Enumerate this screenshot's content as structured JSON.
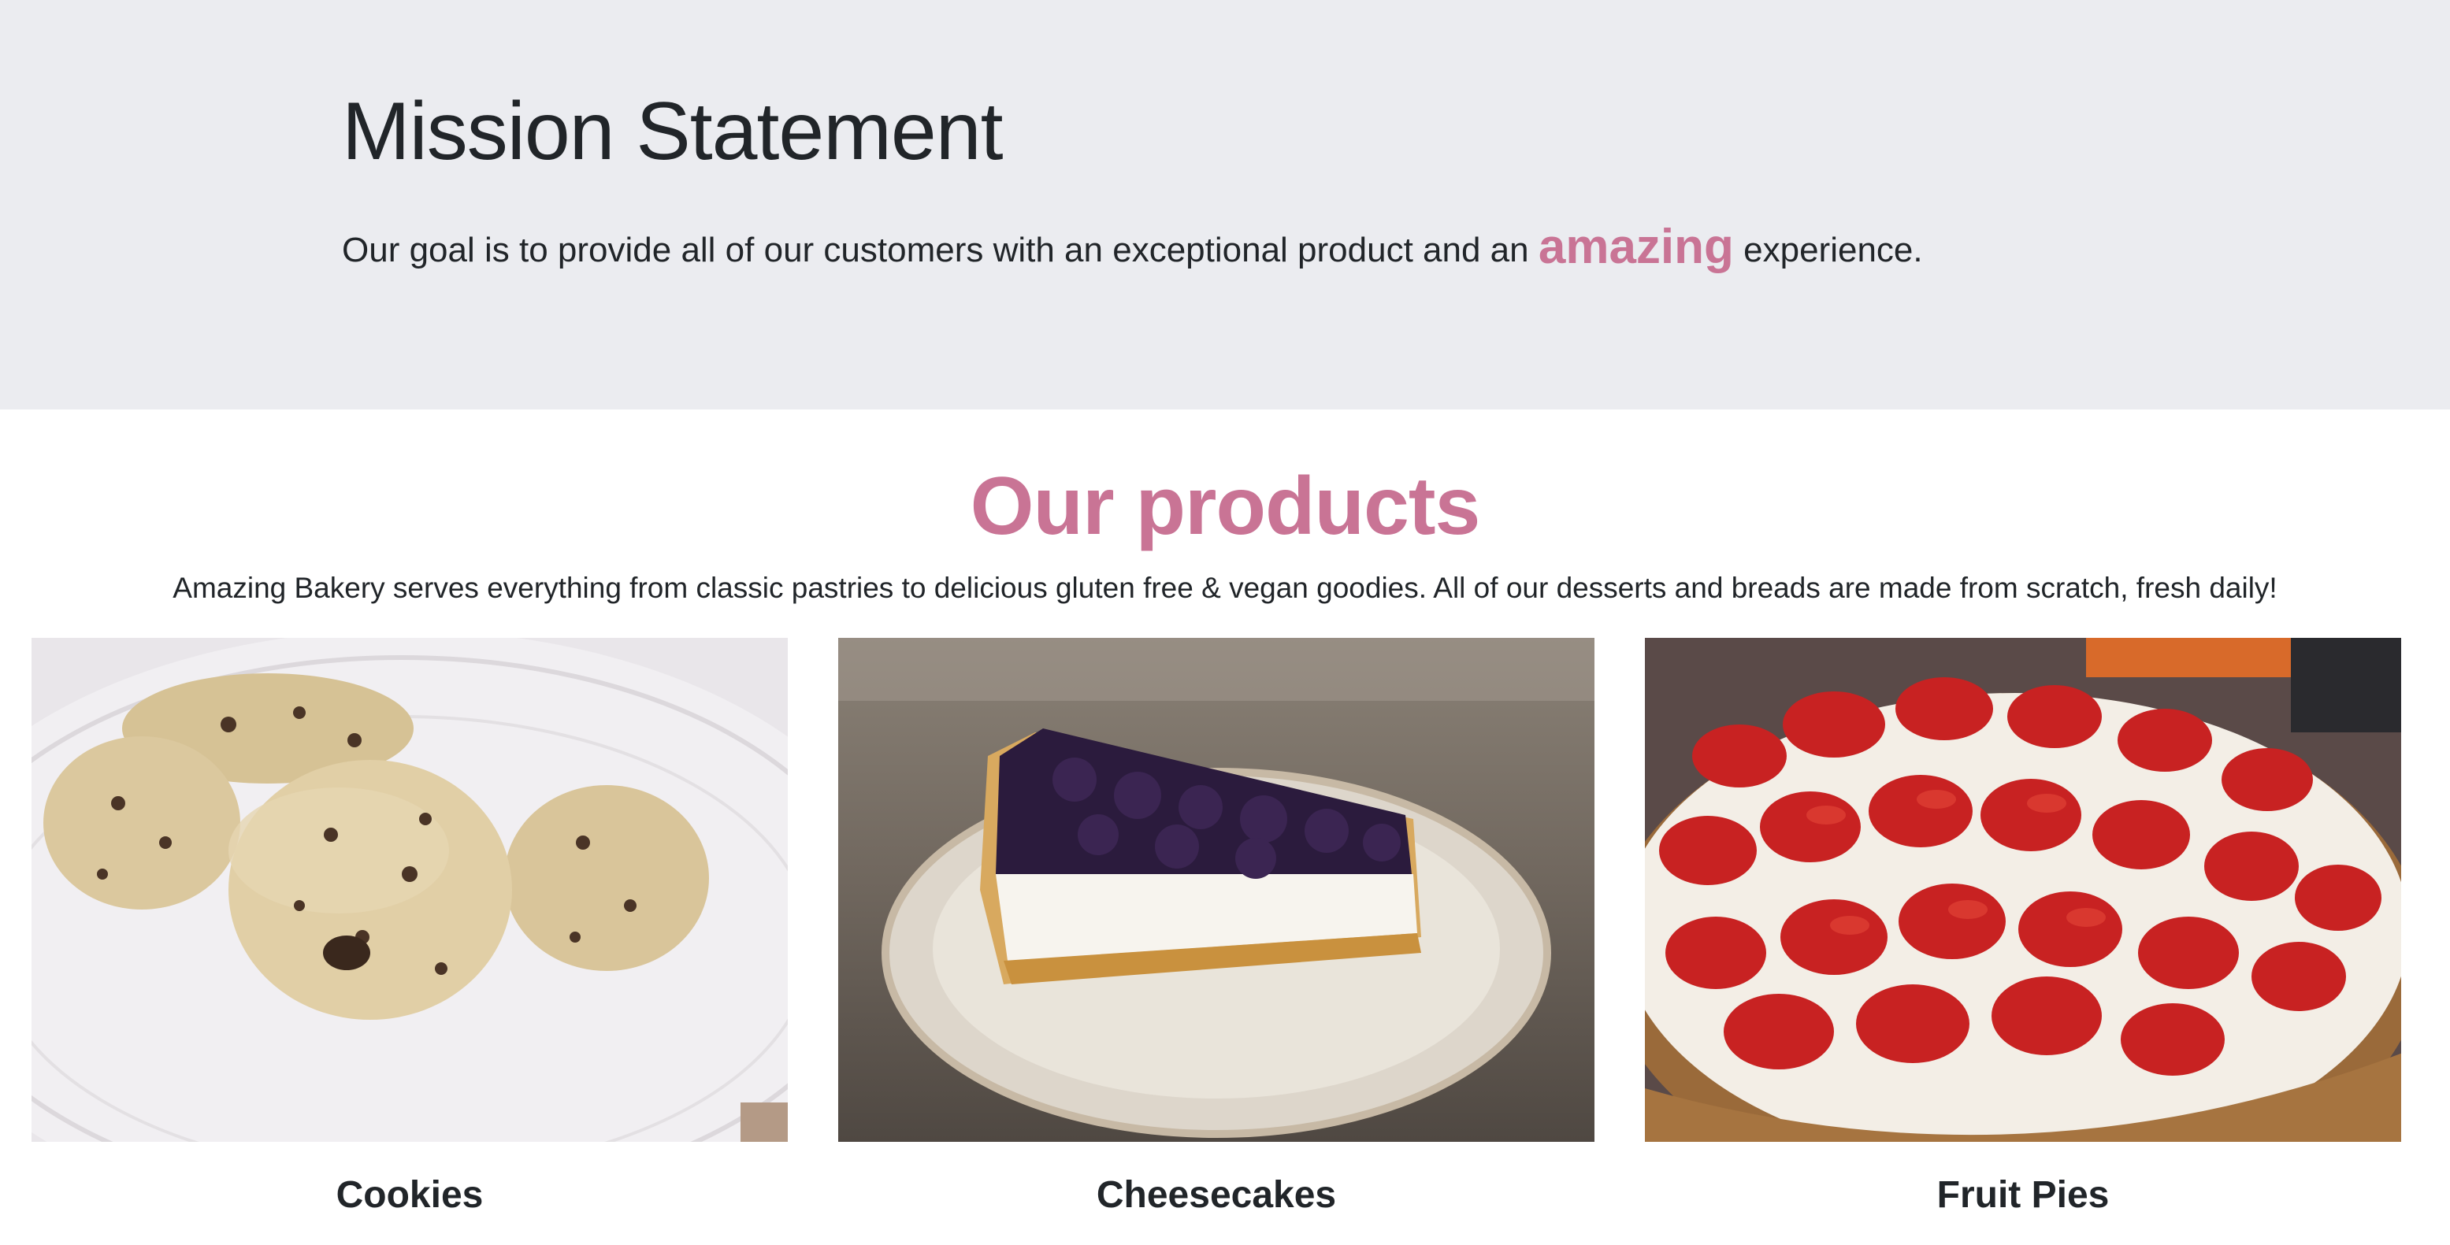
{
  "mission": {
    "title": "Mission Statement",
    "text_before": "Our goal is to provide all of our customers with an exceptional product and an ",
    "accent_word": "amazing",
    "text_after": " experience."
  },
  "products": {
    "title": "Our products",
    "description": "Amazing Bakery serves everything from classic pastries to delicious gluten free & vegan goodies. All of our desserts and breads are made from scratch, fresh daily!",
    "items": [
      {
        "label": "Cookies"
      },
      {
        "label": "Cheesecakes"
      },
      {
        "label": "Fruit Pies"
      }
    ]
  },
  "colors": {
    "accent": "#c97495",
    "jumbotron_bg": "#ebecf0",
    "text": "#212529"
  }
}
